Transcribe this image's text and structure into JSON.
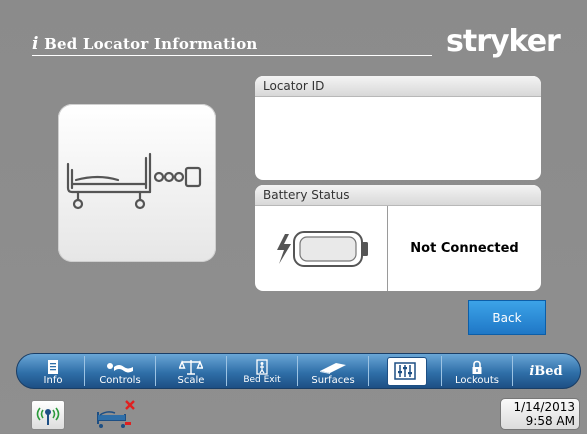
{
  "header": {
    "title_prefix": "i",
    "title": "Bed Locator Information",
    "brand": "stryker"
  },
  "locator_panel": {
    "title": "Locator ID",
    "value": ""
  },
  "battery_panel": {
    "title": "Battery Status",
    "status": "Not Connected"
  },
  "back_button": {
    "label": "Back"
  },
  "tabs": [
    {
      "label": "Info",
      "icon": "info-icon"
    },
    {
      "label": "Controls",
      "icon": "controls-icon"
    },
    {
      "label": "Scale",
      "icon": "scale-icon"
    },
    {
      "label": "Bed Exit",
      "icon": "bed-exit-icon"
    },
    {
      "label": "Surfaces",
      "icon": "surfaces-icon"
    },
    {
      "label": "",
      "icon": "settings-sliders-icon"
    },
    {
      "label": "Lockouts",
      "icon": "lock-icon"
    },
    {
      "label": "Bed",
      "icon": "ibed-logo",
      "prefix": "i"
    }
  ],
  "clock": {
    "date": "1/14/2013",
    "time": "9:58 AM"
  },
  "colors": {
    "accent": "#2f6fa8",
    "button": "#2a8ad6",
    "background": "#8d8d8d"
  }
}
